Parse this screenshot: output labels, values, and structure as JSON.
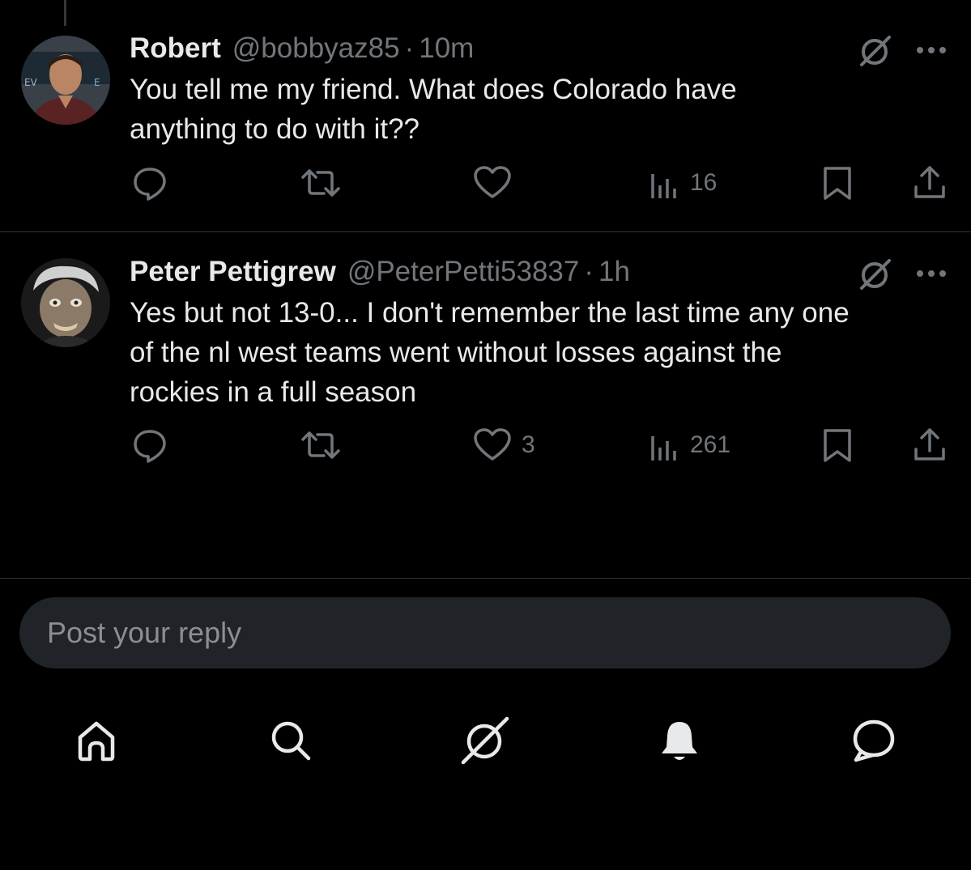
{
  "tweets": [
    {
      "name": "Robert",
      "handle": "@bobbyaz85",
      "separator": "·",
      "time": "10m",
      "text_lines": [
        "You tell me my friend. What does Colorado have",
        "anything to do with it??"
      ],
      "avatar_icon": "user-avatar-photo",
      "counts": {
        "reply": "",
        "repost": "",
        "like": "",
        "views": "16"
      }
    },
    {
      "name": "Peter Pettigrew",
      "handle": "@PeterPetti53837",
      "separator": "·",
      "time": "1h",
      "text_lines": [
        "Yes but not 13-0... I don't remember the last time any one",
        "of the nl west teams went without losses against the",
        "rockies in a full season"
      ],
      "avatar_icon": "user-avatar-photo",
      "counts": {
        "reply": "",
        "repost": "",
        "like": "3",
        "views": "261"
      }
    }
  ],
  "reply": {
    "placeholder": "Post your reply"
  },
  "icons": {
    "tweet_actions": [
      "reply-icon",
      "repost-icon",
      "like-icon",
      "views-icon",
      "bookmark-icon",
      "share-icon"
    ],
    "tweet_header": [
      "grok-icon",
      "more-icon"
    ],
    "bottom_nav": [
      "home-icon",
      "search-icon",
      "grok-icon",
      "notifications-icon",
      "messages-icon"
    ]
  },
  "colors": {
    "background": "#000000",
    "text_primary": "#e7e9ea",
    "text_secondary": "#71767b",
    "divider": "#2f3336",
    "reply_bar": "#202327"
  }
}
